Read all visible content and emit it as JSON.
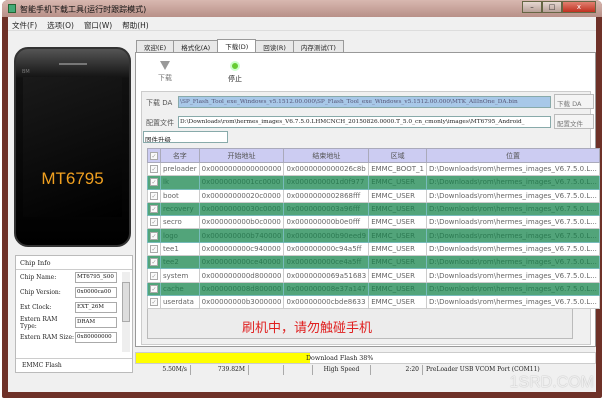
{
  "window": {
    "title": "智能手机下载工具(运行时跟踪模式)",
    "min": "–",
    "max": "□",
    "close": "x"
  },
  "menu": [
    "文件(F)",
    "选项(O)",
    "窗口(W)",
    "帮助(H)"
  ],
  "phone": {
    "model": "MT6795",
    "label": "BM"
  },
  "chip_info": {
    "title": "Chip Info",
    "fields": [
      {
        "label": "Chip Name:",
        "value": "MT6795_S00"
      },
      {
        "label": "Chip Version:",
        "value": "0x0000ca00"
      },
      {
        "label": "Ext Clock:",
        "value": "EXT_26M"
      },
      {
        "label": "Extern RAM Type:",
        "value": "DRAM"
      },
      {
        "label": "Extern RAM Size:",
        "value": "0x80000000"
      }
    ],
    "footer": "EMMC Flash"
  },
  "tabs": [
    "欢迎(E)",
    "格式化(A)",
    "下载(D)",
    "回读(R)",
    "内存测试(T)"
  ],
  "toolbar": {
    "download": "下载",
    "stop": "停止"
  },
  "da": {
    "label": "下载 DA",
    "value": "\\SP_Flash_Tool_exe_Windows_v5.1512.00.000\\SP_Flash_Tool_exe_Windows_v5.1512.00.000\\MTK_AllInOne_DA.bin",
    "button": "下载 DA"
  },
  "scatter": {
    "label": "配置文件",
    "value": "D:\\Downloads\\rom\\hermes_images_V6.7.5.0.LHMCNCH_20150826.0000.T_5.0_cn_cmonly\\images\\MT6795_Android_",
    "button": "配置文件"
  },
  "mode": "固件升级",
  "table": {
    "headers": [
      "名字",
      "开始地址",
      "结束地址",
      "区域",
      "位置"
    ],
    "rows": [
      [
        "preloader",
        "0x0000000000000000",
        "0x0000000000026c8b",
        "EMMC_BOOT_1",
        "D:\\Downloads\\rom\\hermes_images_V6.7.5.0.L..."
      ],
      [
        "lk",
        "0x0000000001cc0000",
        "0x0000000001d0f977",
        "EMMC_USER",
        "D:\\Downloads\\rom\\hermes_images_V6.7.5.0.L..."
      ],
      [
        "boot",
        "0x00000000020c0000",
        "0x0000000002868fff",
        "EMMC_USER",
        "D:\\Downloads\\rom\\hermes_images_V6.7.5.0.L..."
      ],
      [
        "recovery",
        "0x00000000030c0000",
        "0x0000000003a96fff",
        "EMMC_USER",
        "D:\\Downloads\\rom\\hermes_images_V6.7.5.0.L..."
      ],
      [
        "secro",
        "0x000000000b0c0000",
        "0x000000000b0e0fff",
        "EMMC_USER",
        "D:\\Downloads\\rom\\hermes_images_V6.7.5.0.L..."
      ],
      [
        "logo",
        "0x000000000b740000",
        "0x000000000b90eed9",
        "EMMC_USER",
        "D:\\Downloads\\rom\\hermes_images_V6.7.5.0.L..."
      ],
      [
        "tee1",
        "0x000000000c940000",
        "0x000000000c94a5ff",
        "EMMC_USER",
        "D:\\Downloads\\rom\\hermes_images_V6.7.5.0.L..."
      ],
      [
        "tee2",
        "0x000000000ce40000",
        "0x000000000ce4a5ff",
        "EMMC_USER",
        "D:\\Downloads\\rom\\hermes_images_V6.7.5.0.L..."
      ],
      [
        "system",
        "0x000000000d800000",
        "0x0000000069a51683",
        "EMMC_USER",
        "D:\\Downloads\\rom\\hermes_images_V6.7.5.0.L..."
      ],
      [
        "cache",
        "0x000000008d800000",
        "0x000000008e37a147",
        "EMMC_USER",
        "D:\\Downloads\\rom\\hermes_images_V6.7.5.0.L..."
      ],
      [
        "userdata",
        "0x00000000b3000000",
        "0x00000000cbde8633",
        "EMMC_USER",
        "D:\\Downloads\\rom\\hermes_images_V6.7.5.0.L..."
      ]
    ]
  },
  "warning": "刷机中，请勿触碰手机",
  "progress": {
    "text": "Download Flash 38%",
    "percent": 38
  },
  "status": [
    "5.50M/s",
    "739.82M",
    "",
    "",
    "High Speed",
    "2:20",
    "PreLoader USB VCOM Port (COM11)"
  ],
  "watermark": "1SRD.COM"
}
